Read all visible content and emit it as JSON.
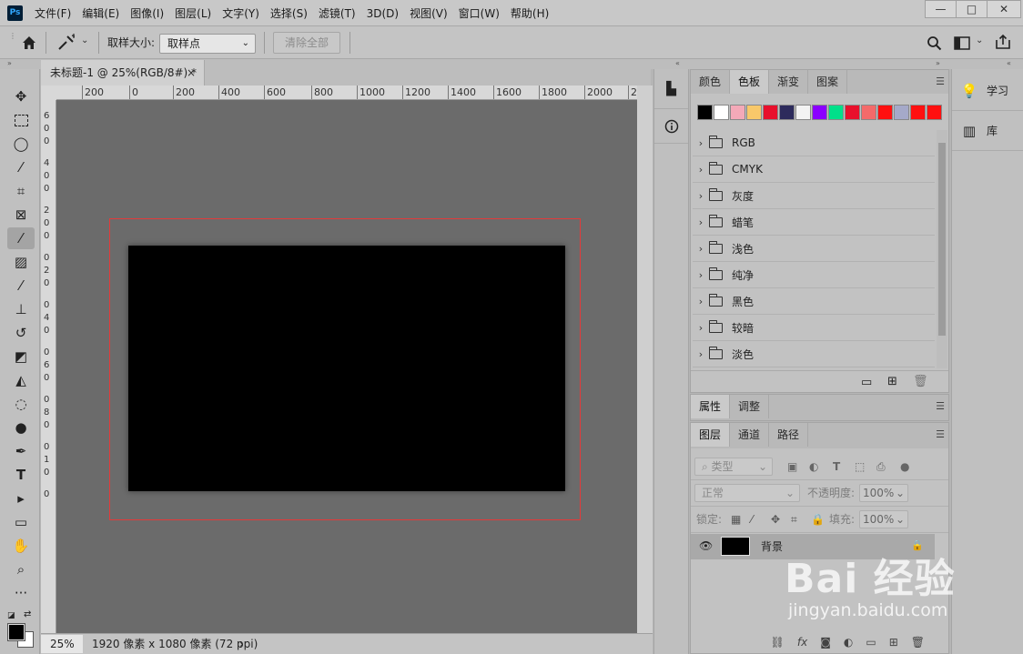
{
  "app": {
    "logo": "Ps"
  },
  "menu": [
    "文件(F)",
    "编辑(E)",
    "图像(I)",
    "图层(L)",
    "文字(Y)",
    "选择(S)",
    "滤镜(T)",
    "3D(D)",
    "视图(V)",
    "窗口(W)",
    "帮助(H)"
  ],
  "window_controls": {
    "minimize": "—",
    "maximize": "□",
    "close": "✕"
  },
  "options_bar": {
    "sample_size_label": "取样大小:",
    "sample_size_value": "取样点",
    "clear_all": "清除全部"
  },
  "document": {
    "tab_title": "未标题-1 @ 25%(RGB/8#) *",
    "tab_close": "×",
    "ruler_top_labels": [
      "200",
      "0",
      "200",
      "400",
      "600",
      "800",
      "1000",
      "1200",
      "1400",
      "1600",
      "1800",
      "2000",
      "2"
    ],
    "ruler_left_labels": [
      "6",
      "0",
      "0",
      "4",
      "0",
      "0",
      "2",
      "0",
      "0",
      "0",
      "2",
      "0",
      "0",
      "4",
      "0",
      "0",
      "6",
      "0",
      "0",
      "8",
      "0",
      "0",
      "1",
      "0",
      "0"
    ],
    "zoom": "25%",
    "doc_size": "1920 像素 x 1080 像素 (72 ppi)",
    "status_arrow": "›"
  },
  "colors": {
    "canvas": "#000000",
    "workspace": "#6b6b6b",
    "selection_border": "#e43a3a"
  },
  "swatches_panel": {
    "tabs": [
      "颜色",
      "色板",
      "渐变",
      "图案"
    ],
    "active_tab": "色板",
    "swatches": [
      "#000000",
      "#ffffff",
      "#f4a9b8",
      "#f8c86a",
      "#e8102c",
      "#2d2b5c",
      "#f3f3f3",
      "#8b00ff",
      "#00e08a",
      "#e8102c",
      "#f46a6a",
      "#ff1010",
      "#a5a9c9",
      "#ff1010",
      "#ff1010"
    ],
    "groups": [
      "RGB",
      "CMYK",
      "灰度",
      "蜡笔",
      "浅色",
      "纯净",
      "黑色",
      "较暗",
      "淡色"
    ]
  },
  "properties_panel": {
    "tabs": [
      "属性",
      "调整"
    ]
  },
  "layers_panel": {
    "tabs": [
      "图层",
      "通道",
      "路径"
    ],
    "filter_type": "类型",
    "blend_mode": "正常",
    "opacity_label": "不透明度:",
    "opacity_value": "100%",
    "lock_label": "锁定:",
    "fill_label": "填充:",
    "fill_value": "100%",
    "layer_name": "背景"
  },
  "far_panel": {
    "learn": "学习",
    "library": "库"
  },
  "watermark": {
    "logo_text": "Bai 经验",
    "url": "jingyan.baidu.com"
  }
}
